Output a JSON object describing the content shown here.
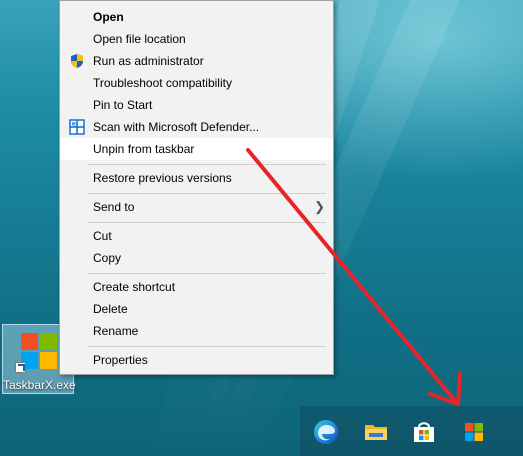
{
  "desktop": {
    "shortcut_label": "TaskbarX.exe",
    "shortcut_icon": "taskbarx-logo-icon"
  },
  "context_menu": {
    "items": [
      {
        "label": "Open",
        "bold": true
      },
      {
        "label": "Open file location"
      },
      {
        "label": "Run as administrator",
        "icon": "uac-shield-icon"
      },
      {
        "label": "Troubleshoot compatibility"
      },
      {
        "label": "Pin to Start"
      },
      {
        "label": "Scan with Microsoft Defender...",
        "icon": "defender-icon"
      },
      {
        "label": "Unpin from taskbar",
        "highlighted": true
      },
      {
        "label": "Restore previous versions"
      },
      {
        "label": "Send to",
        "submenu": true
      },
      {
        "label": "Cut"
      },
      {
        "label": "Copy"
      },
      {
        "label": "Create shortcut"
      },
      {
        "label": "Delete"
      },
      {
        "label": "Rename"
      },
      {
        "label": "Properties"
      }
    ]
  },
  "taskbar": {
    "icons": [
      "edge-icon",
      "file-explorer-icon",
      "microsoft-store-icon",
      "taskbarx-icon"
    ]
  },
  "colors": {
    "annotation_arrow": "#e8232a",
    "menu_bg": "#f2f2f2",
    "highlight_bg": "#ffffff"
  }
}
